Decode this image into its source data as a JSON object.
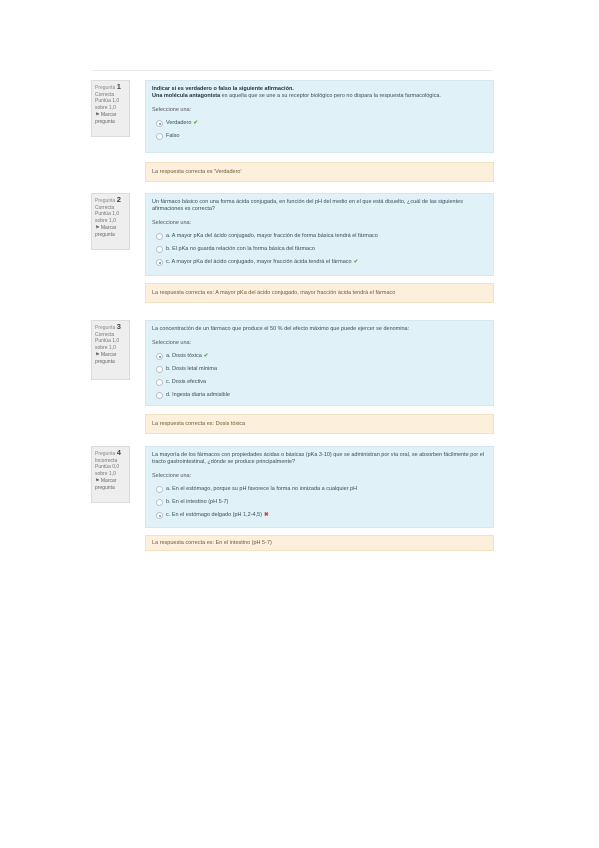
{
  "questions": [
    {
      "label": "Pregunta",
      "number": "1",
      "status": "Correcta",
      "score": "Puntúa 1,0 sobre 1,0",
      "flag": "Marcar pregunta",
      "text_bold": "Indicar si es verdadero o falso la siguiente afirmación.",
      "text_bold2": "Una molécula antagonista",
      "text_rest": " es aquella que se une a su receptor biológico pero no dispara la respuesta farmacológica.",
      "prompt": "Seleccione una:",
      "options": [
        "Verdadero",
        "Falso"
      ],
      "feedback": "La respuesta correcta es 'Verdadero'"
    },
    {
      "label": "Pregunta",
      "number": "2",
      "status": "Correcta",
      "score": "Puntúa 1,0 sobre 1,0",
      "flag": "Marcar pregunta",
      "text": "Un fármaco básico con una forma ácida conjugada, en función del pH del medio en el que está disuelto, ¿cuál de las siguientes afirmaciones es correcta?",
      "prompt": "Seleccione una:",
      "options": [
        "a. A mayor pKa del ácido conjugado, mayor fracción de forma básica tendrá el fármaco",
        "b. El pKa no guarda relación con la forma básica del fármaco",
        "c. A mayor pKa del ácido conjugado, mayor fracción ácida tendrá el fármaco"
      ],
      "feedback": "La respuesta correcta es: A mayor pKa del ácido conjugado, mayor fracción ácida tendrá el fármaco"
    },
    {
      "label": "Pregunta",
      "number": "3",
      "status": "Correcta",
      "score": "Puntúa 1,0 sobre 1,0",
      "flag": "Marcar pregunta",
      "text": "La concentración de un fármaco que produce el 50 % del efecto máximo que puede ejercer se denomina:",
      "prompt": "Seleccione una:",
      "options": [
        "a. Dosis tóxica",
        "b. Dosis letal mínima",
        "c. Dosis efectiva",
        "d. Ingesta diaria admisible"
      ],
      "feedback": "La respuesta correcta es: Dosis tóxica"
    },
    {
      "label": "Pregunta",
      "number": "4",
      "status": "Incorrecta",
      "score": "Puntúa 0,0 sobre 1,0",
      "flag": "Marcar pregunta",
      "text": "La mayoría de los fármacos con propiedades ácidas o básicas (pKa 3-10) que se administran por vía oral, se absorben fácilmente por el tracto gastrointestinal, ¿dónde se produce principalmente?",
      "prompt": "Seleccione una:",
      "options": [
        "a. En el estómago, porque su pH favorece la forma no ionizada a cualquier pH",
        "b. En el intestino (pH 5-7)",
        "c. En el estómago delgado (pH 1,2-4,5)"
      ],
      "feedback": "La respuesta correcta es: En el intestino (pH 5-7)"
    }
  ]
}
